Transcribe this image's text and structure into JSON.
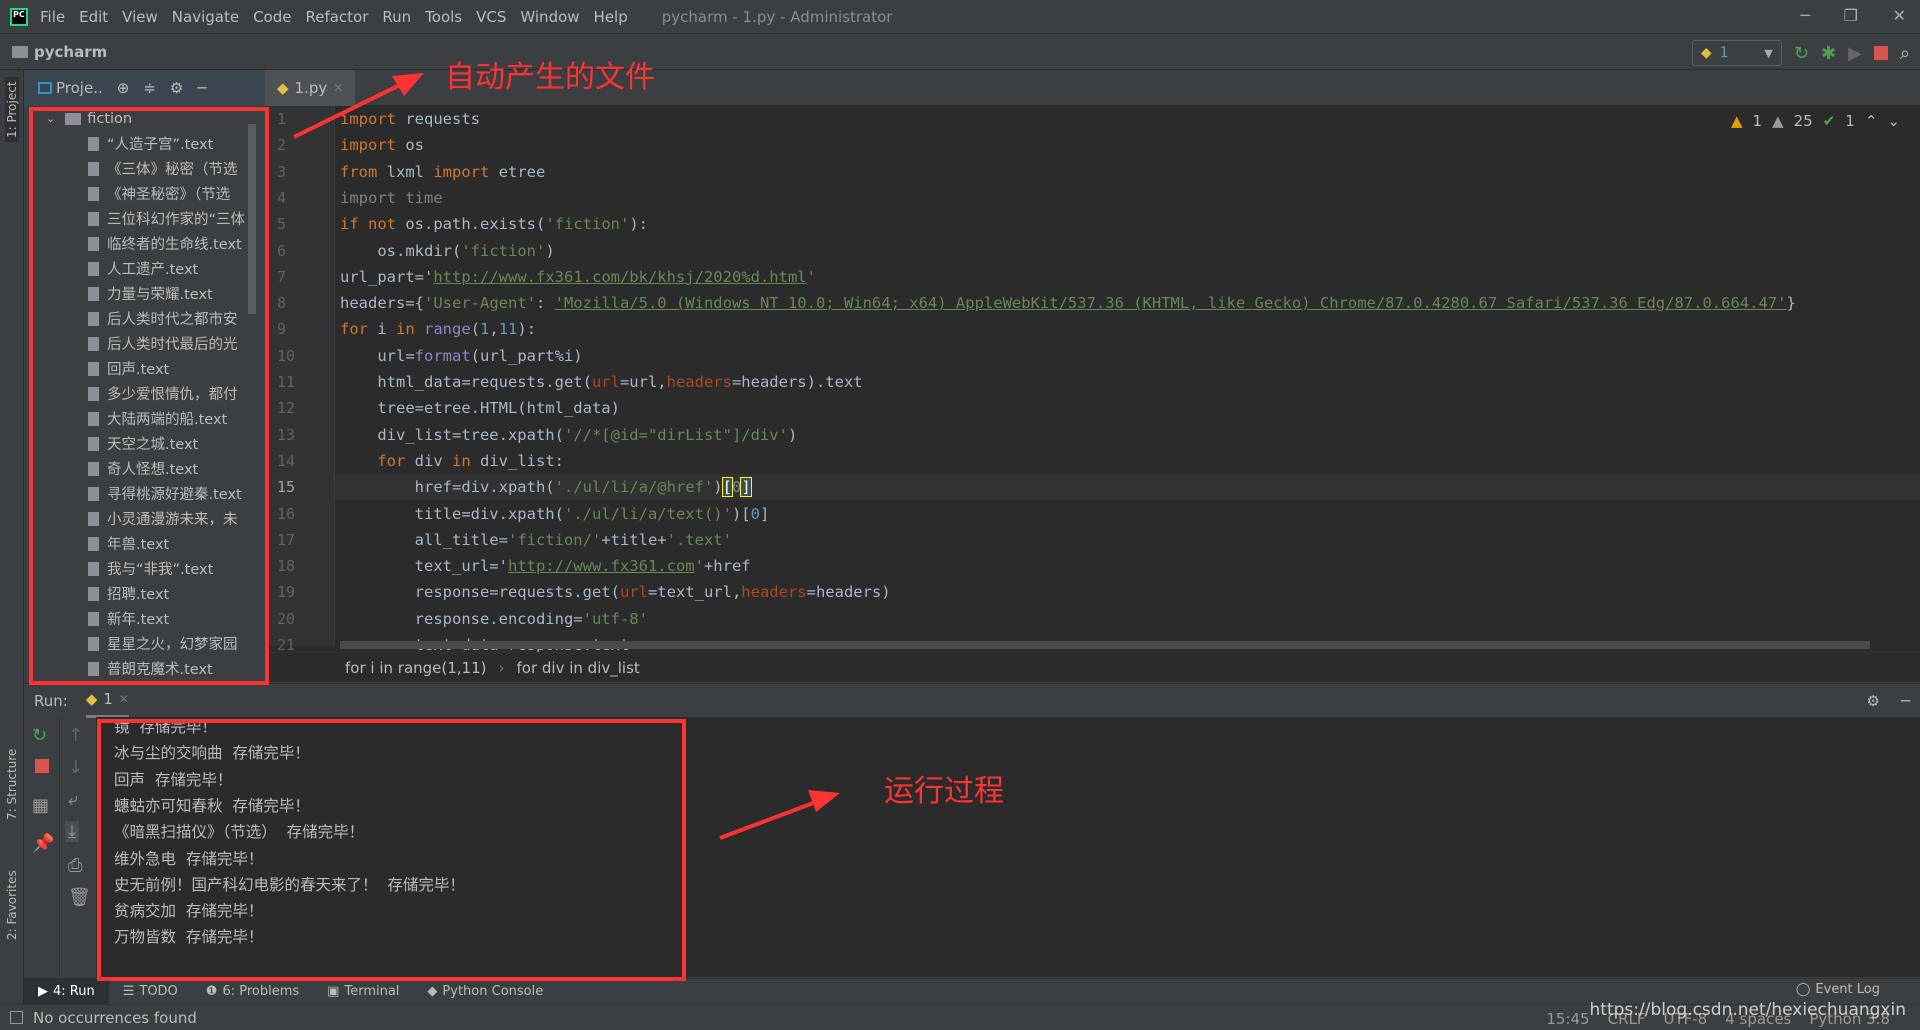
{
  "menubar": {
    "items": [
      "File",
      "Edit",
      "View",
      "Navigate",
      "Code",
      "Refactor",
      "Run",
      "Tools",
      "VCS",
      "Window",
      "Help"
    ],
    "window_title": "pycharm - 1.py - Administrator"
  },
  "navbar": {
    "project_name": "pycharm"
  },
  "run_toolbar": {
    "config": "1"
  },
  "left_stripe": {
    "project": "1: Project",
    "structure": "7: Structure",
    "favorites": "2: Favorites"
  },
  "project_panel": {
    "title": "Proje..",
    "folder": "fiction",
    "files": [
      "“人造子宫”.text",
      "《三体》秘密（节选",
      "《神圣秘密》（节选",
      "三位科幻作家的“三体",
      "临终者的生命线.text",
      "人工遗产.text",
      "力量与荣耀.text",
      "后人类时代之都市安",
      "后人类时代最后的光",
      "回声.text",
      "多少爱恨情仇，都付",
      "大陆两端的船.text",
      "天空之城.text",
      "奇人怪想.text",
      "寻得桃源好避秦.text",
      "小灵通漫游未来，未",
      "年兽.text",
      "我与“非我”.text",
      "招聘.text",
      "新年.text",
      "星星之火，幻梦家园",
      "普朗克魔术.text"
    ]
  },
  "editor": {
    "tab": "1.py",
    "current_line": 15,
    "inspections": {
      "warnings": "1",
      "weak_warnings": "25",
      "typos": "1"
    },
    "lines": [
      [
        [
          "import",
          "kw"
        ],
        [
          " requests",
          ""
        ]
      ],
      [
        [
          "import",
          "kw"
        ],
        [
          " os",
          ""
        ]
      ],
      [
        [
          "from",
          "kw"
        ],
        [
          " lxml ",
          ""
        ],
        [
          "import",
          "kw"
        ],
        [
          " etree",
          ""
        ]
      ],
      [
        [
          "import",
          "dim"
        ],
        [
          " time",
          "dim"
        ]
      ],
      [
        [
          "if",
          "kw"
        ],
        [
          " ",
          ""
        ],
        [
          "not",
          "kw"
        ],
        [
          " os.path.exists(",
          ""
        ],
        [
          "'fiction'",
          "str"
        ],
        [
          "):",
          ""
        ]
      ],
      [
        [
          "    os.mkdir(",
          ""
        ],
        [
          "'fiction'",
          "str"
        ],
        [
          ")",
          ""
        ]
      ],
      [
        [
          "url_part=",
          ""
        ],
        [
          "'",
          ""
        ],
        [
          "http://www.fx361.com/bk/khsj/2020%d.html",
          "url"
        ],
        [
          "'",
          "str"
        ]
      ],
      [
        [
          "headers={",
          ""
        ],
        [
          "'User-Agent'",
          "str"
        ],
        [
          ": ",
          ""
        ],
        [
          "'Mozilla/5.0 (Windows NT 10.0; Win64; x64) AppleWebKit/537.36 (KHTML, like Gecko) Chrome/87.0.4280.67 Safari/537.36 Edg/87.0.664.47'",
          "url"
        ],
        [
          "}",
          ""
        ]
      ],
      [
        [
          "for",
          "kw"
        ],
        [
          " i ",
          ""
        ],
        [
          "in",
          "kw"
        ],
        [
          " ",
          ""
        ],
        [
          "range",
          "bi"
        ],
        [
          "(",
          ""
        ],
        [
          "1",
          "num"
        ],
        [
          ",",
          ""
        ],
        [
          "11",
          "num"
        ],
        [
          "):",
          ""
        ]
      ],
      [
        [
          "    url=",
          ""
        ],
        [
          "format",
          "bi"
        ],
        [
          "(url_part%i)",
          ""
        ]
      ],
      [
        [
          "    html_data=requests.get(",
          ""
        ],
        [
          "url",
          "par"
        ],
        [
          "=url,",
          ""
        ],
        [
          "headers",
          "par"
        ],
        [
          "=headers).text",
          ""
        ]
      ],
      [
        [
          "    tree=etree.HTML(html_data)",
          ""
        ]
      ],
      [
        [
          "    div_list=tree.xpath(",
          ""
        ],
        [
          "'//*[@id=\"dirList\"]/div'",
          "str"
        ],
        [
          ")",
          ""
        ]
      ],
      [
        [
          "    ",
          ""
        ],
        [
          "for",
          "kw"
        ],
        [
          " div ",
          ""
        ],
        [
          "in",
          "kw"
        ],
        [
          " div_list:",
          ""
        ]
      ],
      [
        [
          "        href=div.xpath(",
          ""
        ],
        [
          "'./ul/li/a/@href'",
          "str"
        ],
        [
          ")",
          ""
        ],
        [
          "[",
          "brk"
        ],
        [
          "0",
          "num"
        ],
        [
          "]",
          "brk"
        ]
      ],
      [
        [
          "        title=div.xpath(",
          ""
        ],
        [
          "'./ul/li/a/text()'",
          "str"
        ],
        [
          ")[",
          ""
        ],
        [
          "0",
          "num"
        ],
        [
          "]",
          ""
        ]
      ],
      [
        [
          "        all_title=",
          ""
        ],
        [
          "'fiction/'",
          "str"
        ],
        [
          "+title+",
          ""
        ],
        [
          "'.text'",
          "str"
        ]
      ],
      [
        [
          "        text_url=",
          ""
        ],
        [
          "'",
          ""
        ],
        [
          "http://www.fx361.com",
          "url"
        ],
        [
          "'",
          "str"
        ],
        [
          "+href",
          ""
        ]
      ],
      [
        [
          "        response=requests.get(",
          ""
        ],
        [
          "url",
          "par"
        ],
        [
          "=text_url,",
          ""
        ],
        [
          "headers",
          "par"
        ],
        [
          "=headers)",
          ""
        ]
      ],
      [
        [
          "        response.encoding=",
          ""
        ],
        [
          "'utf-8'",
          "str"
        ]
      ],
      [
        [
          "        text_data=response.text",
          ""
        ]
      ]
    ],
    "breadcrumb": [
      "for i in range(1,11)",
      "for div in div_list"
    ]
  },
  "run_panel": {
    "label": "Run:",
    "tab": "1",
    "output": [
      "镜  存储完毕！",
      "冰与尘的交响曲  存储完毕！",
      "回声  存储完毕！",
      "蟪蛄亦可知春秋  存储完毕！",
      "《暗黑扫描仪》（节选）  存储完毕！",
      "维外急电  存储完毕！",
      "史无前例！国产科幻电影的春天来了！  存储完毕！",
      "贫病交加  存储完毕！",
      "万物皆数  存储完毕！"
    ]
  },
  "tool_tabs": [
    "4: Run",
    "TODO",
    "6: Problems",
    "Terminal",
    "Python Console"
  ],
  "event_log": "Event Log",
  "status": {
    "message": "No occurrences found",
    "position": "15:45",
    "line_sep": "CRLF",
    "encoding": "UTF-8",
    "indent": "4 spaces",
    "interpreter": "Python 3.8"
  },
  "watermark": "https://blog.csdn.net/hexiechuangxin",
  "annotations": {
    "files": "自动产生的文件",
    "run": "运行过程",
    "color": "#ff3333"
  }
}
